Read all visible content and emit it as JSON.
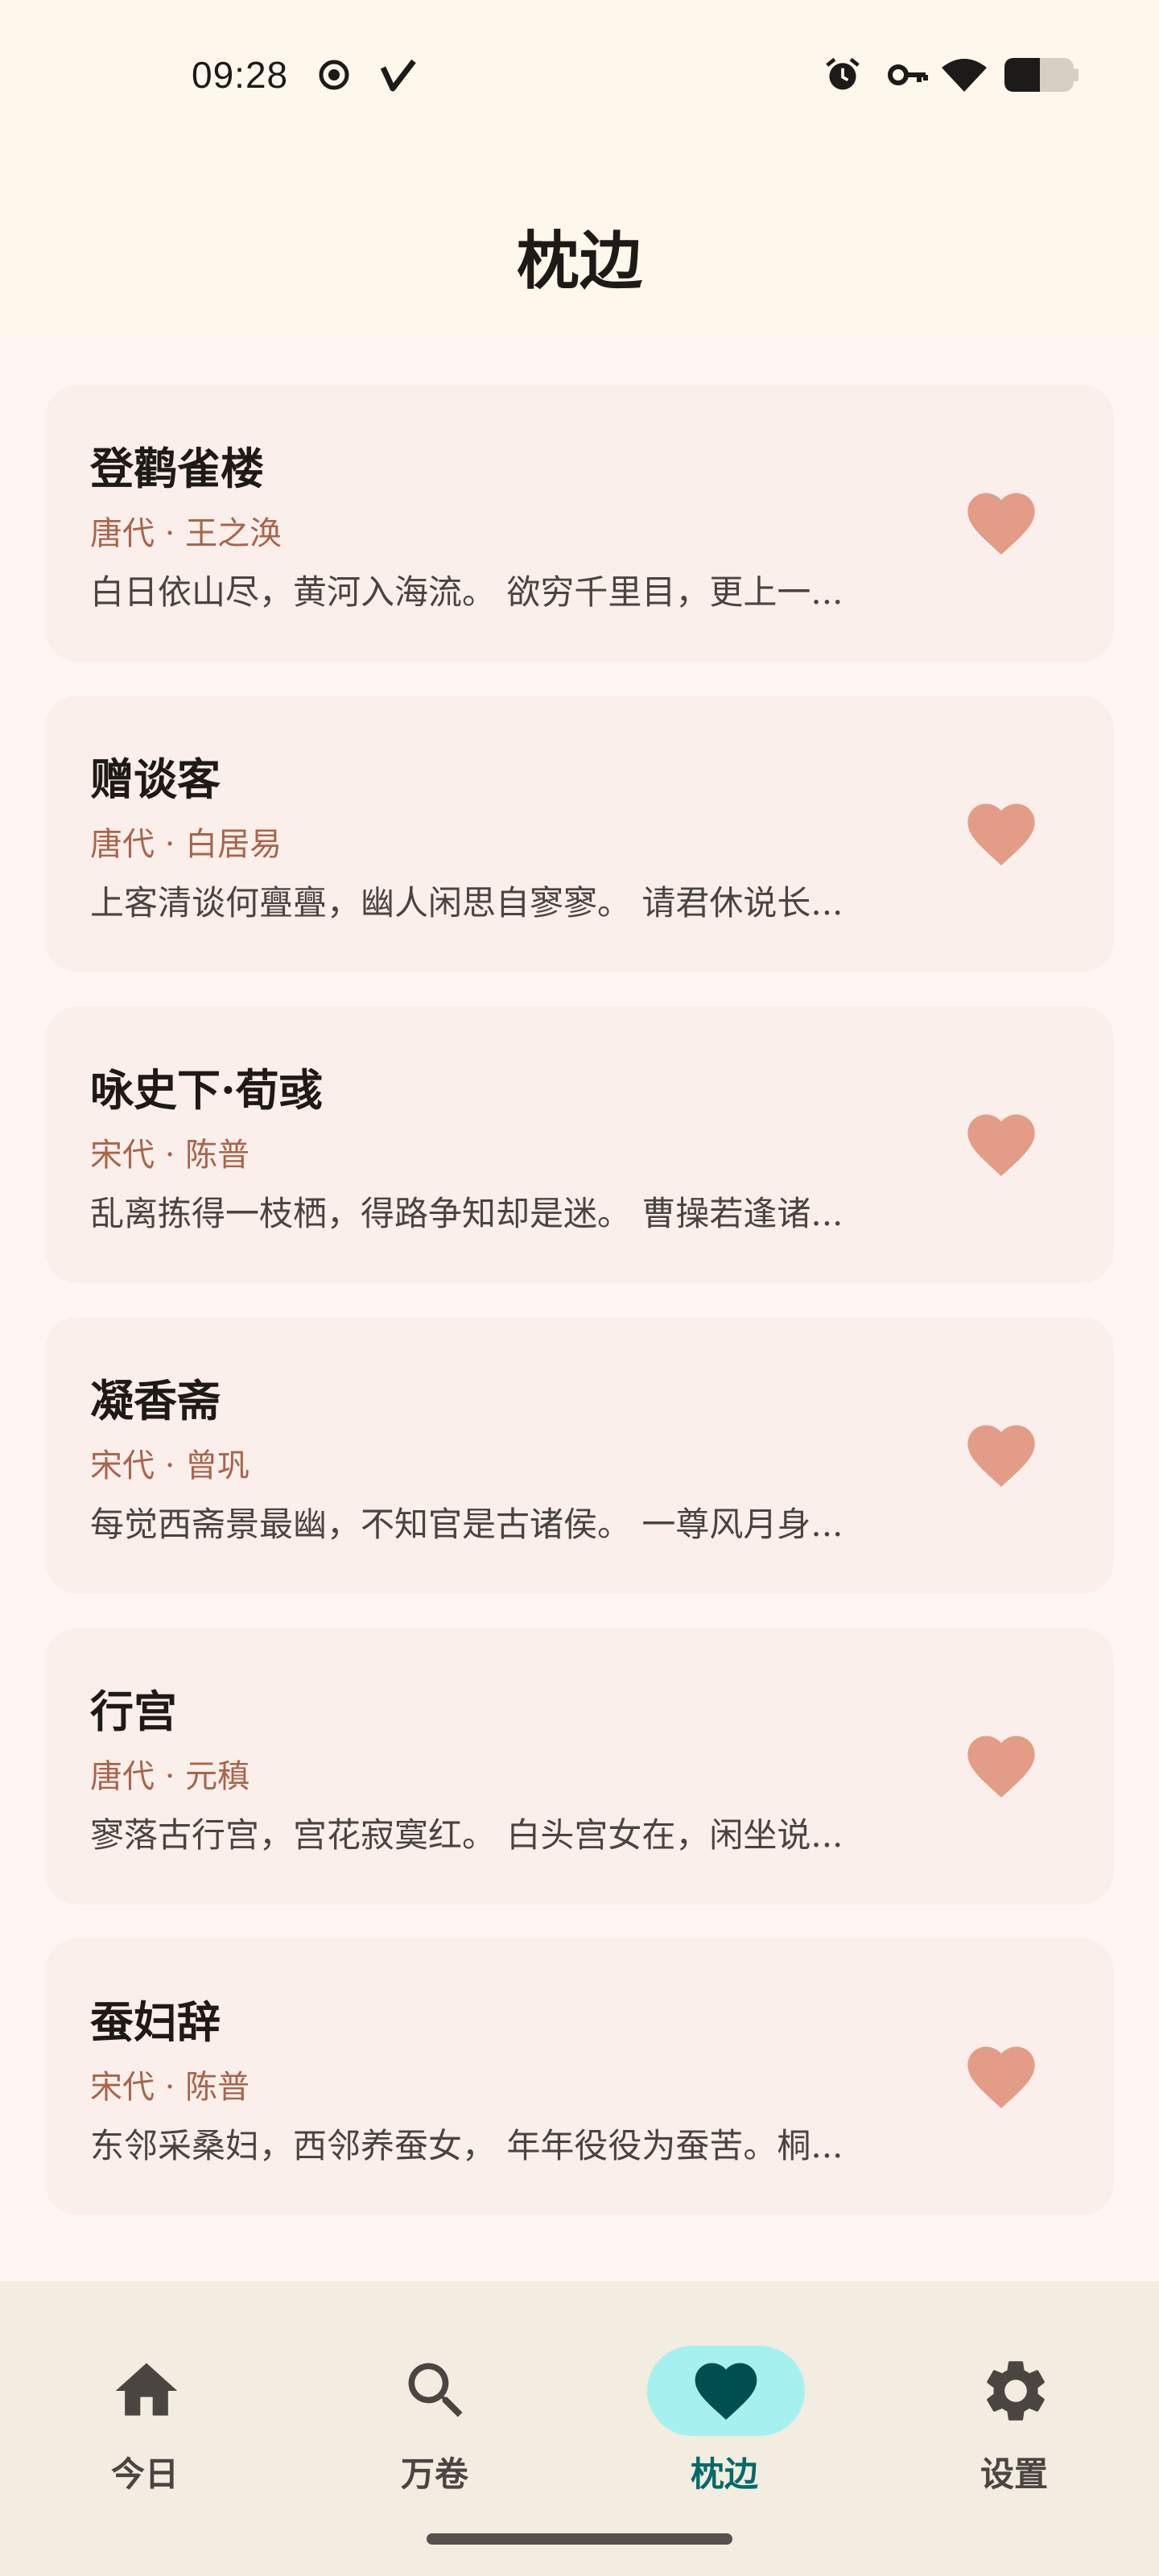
{
  "status_bar": {
    "time": "09:28",
    "left_icons": [
      "record-icon",
      "check-icon"
    ],
    "right_icons": [
      "alarm-icon",
      "vpn-key-icon",
      "wifi-icon",
      "battery-icon"
    ]
  },
  "header": {
    "title": "枕边"
  },
  "favorites": [
    {
      "title": "登鹳雀楼",
      "meta": "唐代 · 王之涣",
      "excerpt": "白日依山尽，黄河入海流。 欲穷千里目，更上一..."
    },
    {
      "title": "赠谈客",
      "meta": "唐代 · 白居易",
      "excerpt": "上客清谈何亹亹，幽人闲思自寥寥。 请君休说长..."
    },
    {
      "title": "咏史下·荀彧",
      "meta": "宋代 · 陈普",
      "excerpt": "乱离拣得一枝栖，得路争知却是迷。 曹操若逢诸..."
    },
    {
      "title": "凝香斋",
      "meta": "宋代 · 曾巩",
      "excerpt": "每觉西斋景最幽，不知官是古诸侯。 一尊风月身..."
    },
    {
      "title": "行宫",
      "meta": "唐代 · 元稹",
      "excerpt": "寥落古行宫，宫花寂寞红。 白头宫女在，闲坐说..."
    },
    {
      "title": "蚕妇辞",
      "meta": "宋代 · 陈普",
      "excerpt": "东邻采桑妇，西邻养蚕女， 年年役役为蚕苦。桐..."
    }
  ],
  "bottom_nav": {
    "items": [
      {
        "label": "今日",
        "icon": "home-icon"
      },
      {
        "label": "万卷",
        "icon": "search-icon"
      },
      {
        "label": "枕边",
        "icon": "heart-icon",
        "active": true
      },
      {
        "label": "设置",
        "icon": "gear-icon"
      }
    ]
  },
  "colors": {
    "header_bg": "#FEF7EB",
    "card_bg": "#FBEFEB",
    "heart": "#E39D86",
    "meta_text": "#A8654B",
    "nav_active_pill": "#A6F0F0",
    "nav_active_icon": "#004F4F"
  }
}
